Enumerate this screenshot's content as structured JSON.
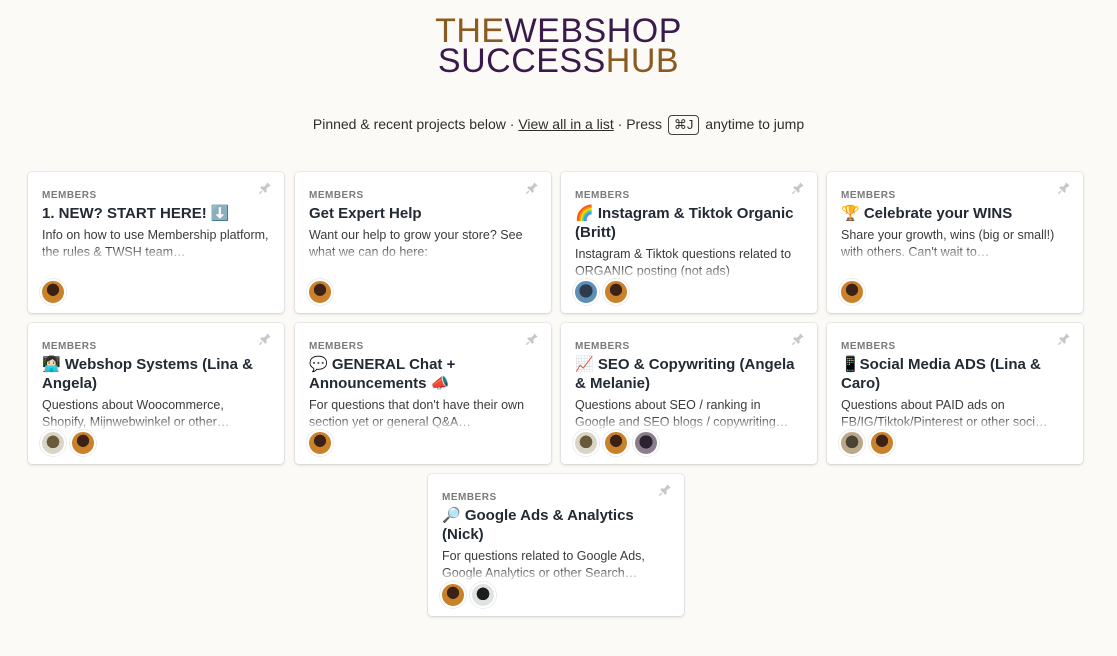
{
  "logo": {
    "line1_a": "THE",
    "line1_b": "WEBSHOP",
    "line2_a": "SUCCESS",
    "line2_b": "HUB",
    "color_gold": "#8a5a1e",
    "color_purple": "#3a1a4a"
  },
  "tagline": {
    "prefix": "Pinned & recent projects below · ",
    "link": "View all in a list",
    "middle": " · Press ",
    "shortcut": "⌘J",
    "suffix": " anytime to jump"
  },
  "projects": [
    {
      "eyebrow": "MEMBERS",
      "title": "1. NEW? START HERE! ⬇️",
      "description": "Info on how to use Membership platform, the rules & TWSH team…",
      "avatars": [
        "av-a"
      ]
    },
    {
      "eyebrow": "MEMBERS",
      "title": "Get Expert Help",
      "description": "Want our help to grow your store? See what we can do here:",
      "avatars": [
        "av-a"
      ]
    },
    {
      "eyebrow": "MEMBERS",
      "title": "🌈 Instagram & Tiktok Organic (Britt)",
      "description": "Instagram & Tiktok questions related to ORGANIC posting (not ads)",
      "avatars": [
        "av-b",
        "av-a"
      ]
    },
    {
      "eyebrow": "MEMBERS",
      "title": "🏆 Celebrate your WINS",
      "description": "Share your growth, wins (big or small!) with others. Can't wait to…",
      "avatars": [
        "av-a"
      ]
    },
    {
      "eyebrow": "MEMBERS",
      "title": "👩🏻‍💻 Webshop Systems (Lina & Angela)",
      "description": "Questions about Woocommerce, Shopify, Mijnwebwinkel or other…",
      "avatars": [
        "av-c",
        "av-a"
      ]
    },
    {
      "eyebrow": "MEMBERS",
      "title": "💬 GENERAL Chat + Announcements 📣",
      "description": "For questions that don't have their own section yet or general Q&A…",
      "avatars": [
        "av-a"
      ]
    },
    {
      "eyebrow": "MEMBERS",
      "title": "📈 SEO & Copywriting (Angela & Melanie)",
      "description": "Questions about SEO / ranking in Google and SEO blogs / copywriting…",
      "avatars": [
        "av-c",
        "av-a",
        "av-d"
      ]
    },
    {
      "eyebrow": "MEMBERS",
      "title": "📱Social Media ADS (Lina & Caro)",
      "description": "Questions about PAID ads on FB/IG/Tiktok/Pinterest or other soci…",
      "avatars": [
        "av-e",
        "av-a"
      ]
    },
    {
      "eyebrow": "MEMBERS",
      "title": "🔎 Google Ads & Analytics (Nick)",
      "description": "For questions related to Google Ads, Google Analytics or other Search…",
      "avatars": [
        "av-a",
        "av-f"
      ]
    }
  ]
}
